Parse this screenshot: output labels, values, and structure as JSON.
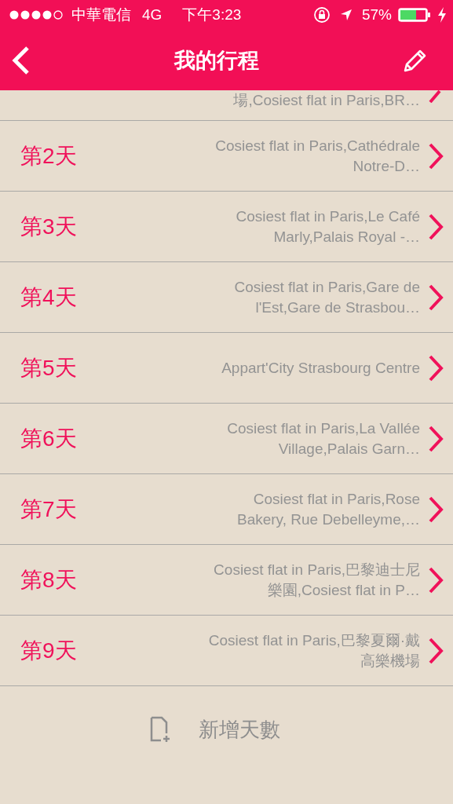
{
  "status_bar": {
    "carrier": "中華電信",
    "network": "4G",
    "time": "下午3:23",
    "battery": "57%"
  },
  "nav_bar": {
    "title": "我的行程"
  },
  "partial_day": {
    "places": "場,Cosiest flat in Paris,BR…"
  },
  "days": [
    {
      "label": "第2天",
      "places": "Cosiest flat in Paris,Cathédrale Notre-D…"
    },
    {
      "label": "第3天",
      "places": "Cosiest flat in Paris,Le Café Marly,Palais Royal -…"
    },
    {
      "label": "第4天",
      "places": "Cosiest flat in Paris,Gare de l'Est,Gare de Strasbou…"
    },
    {
      "label": "第5天",
      "places": "Appart'City Strasbourg Centre"
    },
    {
      "label": "第6天",
      "places": "Cosiest flat in Paris,La Vallée Village,Palais Garn…"
    },
    {
      "label": "第7天",
      "places": "Cosiest flat in Paris,Rose Bakery, Rue Debelleyme,…"
    },
    {
      "label": "第8天",
      "places": "Cosiest flat in Paris,巴黎迪士尼樂園,Cosiest flat in P…"
    },
    {
      "label": "第9天",
      "places": "Cosiest flat in Paris,巴黎夏爾·戴高樂機場"
    }
  ],
  "add_day": {
    "label": "新增天數"
  }
}
